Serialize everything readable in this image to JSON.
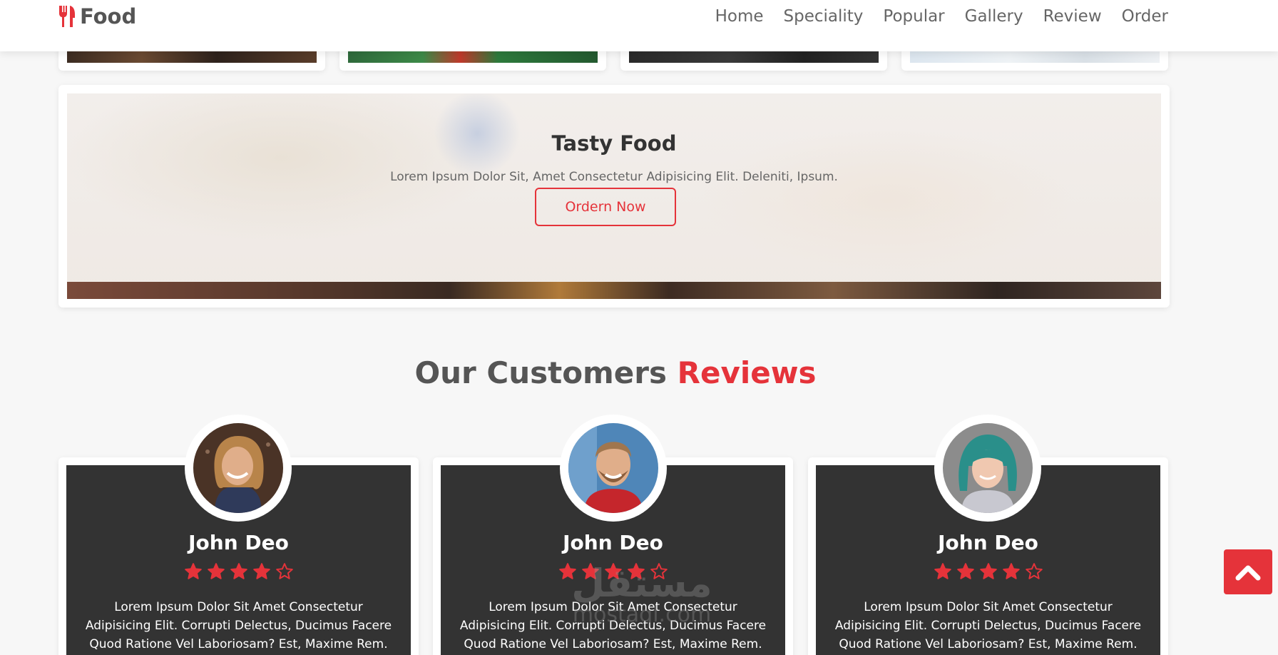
{
  "header": {
    "logo_text": "Food",
    "logo_icon": "utensils-icon",
    "nav": [
      {
        "label": "Home"
      },
      {
        "label": "Speciality"
      },
      {
        "label": "Popular"
      },
      {
        "label": "Gallery"
      },
      {
        "label": "Review"
      },
      {
        "label": "Order"
      }
    ]
  },
  "banner": {
    "title": "Tasty Food",
    "text": "Lorem Ipsum Dolor Sit, Amet Consectetur Adipisicing Elit. Deleniti, Ipsum.",
    "button_label": "Ordern Now"
  },
  "reviews_heading": {
    "prefix": "Our Customers",
    "accent": "Reviews"
  },
  "reviews": [
    {
      "name": "John Deo",
      "rating": 4,
      "max_rating": 5,
      "text": "Lorem Ipsum Dolor Sit Amet Consectetur Adipisicing Elit. Corrupti Delectus, Ducimus Facere Quod Ratione Vel Laboriosam? Est, Maxime Rem."
    },
    {
      "name": "John Deo",
      "rating": 4,
      "max_rating": 5,
      "text": "Lorem Ipsum Dolor Sit Amet Consectetur Adipisicing Elit. Corrupti Delectus, Ducimus Facere Quod Ratione Vel Laboriosam? Est, Maxime Rem."
    },
    {
      "name": "John Deo",
      "rating": 4,
      "max_rating": 5,
      "text": "Lorem Ipsum Dolor Sit Amet Consectetur Adipisicing Elit. Corrupti Delectus, Ducimus Facere Quod Ratione Vel Laboriosam? Est, Maxime Rem."
    }
  ],
  "watermark": {
    "arabic": "مستقل",
    "latin": "mostaql.com"
  },
  "scroll_top_icon": "chevron-up-icon",
  "colors": {
    "accent": "#e5333a",
    "card_dark": "#333333",
    "page_bg": "#f7f7f7"
  }
}
